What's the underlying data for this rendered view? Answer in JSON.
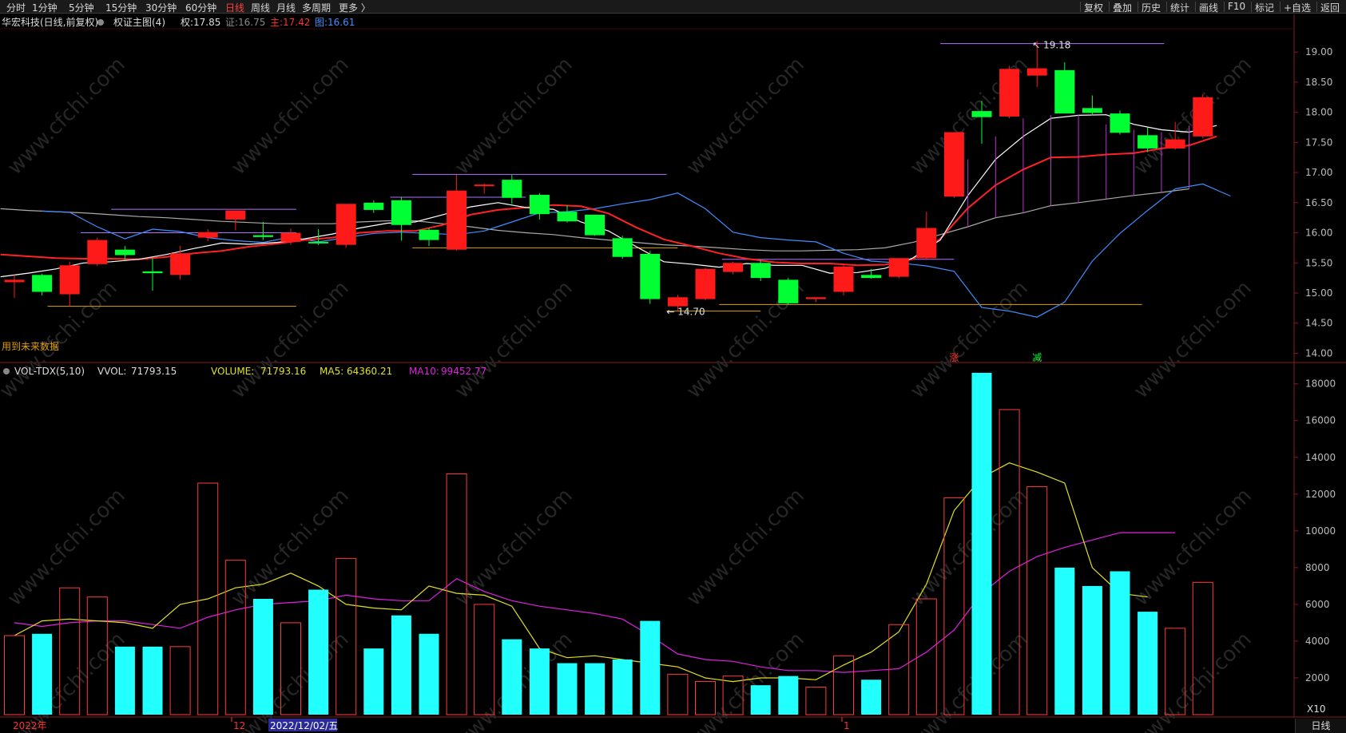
{
  "toolbar": {
    "left": [
      "分时",
      "1分钟",
      "5分钟",
      "15分钟",
      "30分钟",
      "60分钟",
      "日线",
      "周线",
      "月线",
      "多周期",
      "更多 〉"
    ],
    "active": "日线",
    "right": [
      "复权",
      "叠加",
      "历史",
      "统计",
      "画线",
      "F10",
      "标记",
      "+自选",
      "返回"
    ]
  },
  "price_header": {
    "stock": "华宏科技(日线,前复权)",
    "indicator": "权证主图(4)",
    "quan_label": "权:",
    "quan": "17.85",
    "zheng_label": "证:",
    "zheng": "16.75",
    "zhu_label": "主:",
    "zhu": "17.42",
    "tu_label": "图:",
    "tu": "16.61"
  },
  "vol_header": {
    "name": "VOL-TDX(5,10)",
    "vvol_label": "VVOL:",
    "vvol": "71793.15",
    "volume_label": "VOLUME:",
    "volume": "71793.16",
    "ma5_label": "MA5:",
    "ma5": "64360.21",
    "ma10_label": "MA10:",
    "ma10": "99452.77"
  },
  "annotations": {
    "high": "19.18",
    "low": "14.70",
    "future_note": "用到未来数据",
    "zhang": "涨",
    "jian": "减",
    "scale": "X10"
  },
  "watermark": "www.cfchi.com",
  "date_axis": {
    "year": "2022年",
    "m12": "12",
    "cursor": "2022/12/02/五",
    "m1": "1"
  },
  "status_word": "日线",
  "colors": {
    "up": "#ff1a1a",
    "down": "#00ff33",
    "vol_down": "#22ffff",
    "ma_white": "#ffffff",
    "ma_red": "#ff2222",
    "ma_gray": "#aaaaaa",
    "ma_blue": "#3f8fff",
    "vol_ma5": "#e0e020",
    "vol_ma10": "#e020e0",
    "level": "#e0a000",
    "hline": "#b070ff"
  },
  "chart_data": {
    "type": "candlestick",
    "price_axis": {
      "ticks": [
        14.0,
        14.5,
        15.0,
        15.5,
        16.0,
        16.5,
        17.0,
        17.5,
        18.0,
        18.5,
        19.0
      ],
      "range": [
        13.9,
        19.4
      ]
    },
    "volume_axis": {
      "ticks": [
        2000,
        4000,
        6000,
        8000,
        10000,
        12000,
        14000,
        16000,
        18000
      ],
      "range": [
        0,
        18900
      ]
    },
    "candles": [
      {
        "o": 15.18,
        "h": 15.3,
        "l": 14.92,
        "c": 15.22
      },
      {
        "o": 15.3,
        "h": 15.32,
        "l": 14.96,
        "c": 15.02
      },
      {
        "o": 14.98,
        "h": 15.52,
        "l": 14.78,
        "c": 15.46
      },
      {
        "o": 15.48,
        "h": 15.92,
        "l": 15.45,
        "c": 15.88
      },
      {
        "o": 15.72,
        "h": 15.78,
        "l": 15.55,
        "c": 15.63
      },
      {
        "o": 15.36,
        "h": 15.58,
        "l": 15.04,
        "c": 15.33
      },
      {
        "o": 15.3,
        "h": 15.78,
        "l": 15.22,
        "c": 15.66
      },
      {
        "o": 15.92,
        "h": 16.06,
        "l": 15.86,
        "c": 16.01
      },
      {
        "o": 16.22,
        "h": 16.35,
        "l": 16.04,
        "c": 16.37
      },
      {
        "o": 15.96,
        "h": 16.18,
        "l": 15.88,
        "c": 15.93
      },
      {
        "o": 15.85,
        "h": 16.07,
        "l": 15.8,
        "c": 16.0
      },
      {
        "o": 15.85,
        "h": 16.06,
        "l": 15.8,
        "c": 15.84
      },
      {
        "o": 15.8,
        "h": 16.43,
        "l": 15.75,
        "c": 16.48
      },
      {
        "o": 16.5,
        "h": 16.54,
        "l": 16.33,
        "c": 16.38
      },
      {
        "o": 16.54,
        "h": 16.59,
        "l": 15.87,
        "c": 16.13
      },
      {
        "o": 16.05,
        "h": 16.08,
        "l": 15.78,
        "c": 15.88
      },
      {
        "o": 15.72,
        "h": 16.96,
        "l": 15.7,
        "c": 16.7
      },
      {
        "o": 16.8,
        "h": 16.82,
        "l": 16.65,
        "c": 16.8
      },
      {
        "o": 16.88,
        "h": 16.96,
        "l": 16.48,
        "c": 16.58
      },
      {
        "o": 16.63,
        "h": 16.66,
        "l": 16.22,
        "c": 16.31
      },
      {
        "o": 16.35,
        "h": 16.46,
        "l": 16.17,
        "c": 16.19
      },
      {
        "o": 16.3,
        "h": 16.3,
        "l": 15.95,
        "c": 15.96
      },
      {
        "o": 15.91,
        "h": 15.95,
        "l": 15.57,
        "c": 15.6
      },
      {
        "o": 15.65,
        "h": 15.7,
        "l": 14.82,
        "c": 14.9
      },
      {
        "o": 14.78,
        "h": 14.97,
        "l": 14.7,
        "c": 14.93
      },
      {
        "o": 14.9,
        "h": 15.42,
        "l": 14.88,
        "c": 15.4
      },
      {
        "o": 15.35,
        "h": 15.52,
        "l": 15.31,
        "c": 15.5
      },
      {
        "o": 15.5,
        "h": 15.55,
        "l": 15.2,
        "c": 15.25
      },
      {
        "o": 15.22,
        "h": 15.25,
        "l": 14.8,
        "c": 14.83
      },
      {
        "o": 14.9,
        "h": 14.93,
        "l": 14.85,
        "c": 14.93
      },
      {
        "o": 15.02,
        "h": 15.47,
        "l": 14.96,
        "c": 15.44
      },
      {
        "o": 15.3,
        "h": 15.4,
        "l": 15.24,
        "c": 15.25
      },
      {
        "o": 15.27,
        "h": 15.57,
        "l": 15.24,
        "c": 15.58
      },
      {
        "o": 15.58,
        "h": 16.35,
        "l": 15.55,
        "c": 16.08
      },
      {
        "o": 16.6,
        "h": 17.67,
        "l": 16.58,
        "c": 17.67
      },
      {
        "o": 18.02,
        "h": 18.19,
        "l": 17.48,
        "c": 17.92
      },
      {
        "o": 17.93,
        "h": 18.77,
        "l": 17.9,
        "c": 18.72
      },
      {
        "o": 18.61,
        "h": 19.18,
        "l": 18.42,
        "c": 18.73
      },
      {
        "o": 18.7,
        "h": 18.83,
        "l": 17.98,
        "c": 17.98
      },
      {
        "o": 18.07,
        "h": 18.28,
        "l": 17.95,
        "c": 17.99
      },
      {
        "o": 17.98,
        "h": 18.03,
        "l": 17.63,
        "c": 17.66
      },
      {
        "o": 17.62,
        "h": 17.75,
        "l": 17.34,
        "c": 17.4
      },
      {
        "o": 17.4,
        "h": 17.84,
        "l": 17.38,
        "c": 17.55
      },
      {
        "o": 17.6,
        "h": 18.3,
        "l": 17.57,
        "c": 18.25
      }
    ],
    "volume": [
      4300,
      4400,
      6900,
      6400,
      3700,
      3700,
      3700,
      12600,
      8400,
      6300,
      5000,
      6800,
      8500,
      3600,
      5400,
      4400,
      13100,
      6000,
      4100,
      3600,
      2800,
      2800,
      3000,
      5100,
      2200,
      1800,
      2100,
      1600,
      2100,
      1500,
      3200,
      1900,
      4900,
      6300,
      11800,
      18600,
      16600,
      12400,
      8000,
      7000,
      7800,
      5600,
      4700,
      7200
    ],
    "ma_white": [
      15.27,
      15.33,
      15.4,
      15.5,
      15.52,
      15.56,
      15.64,
      15.74,
      15.83,
      15.81,
      15.84,
      15.9,
      15.98,
      16.08,
      16.16,
      16.18,
      16.3,
      16.43,
      16.5,
      16.42,
      16.39,
      16.18,
      16.03,
      15.77,
      15.52,
      15.48,
      15.43,
      15.49,
      15.46,
      15.46,
      15.33,
      15.34,
      15.41,
      15.58,
      15.88,
      16.62,
      17.22,
      17.6,
      17.9,
      17.95,
      17.96,
      17.8,
      17.71,
      17.67,
      17.78
    ],
    "ma_red": [
      15.64,
      15.61,
      15.58,
      15.57,
      15.57,
      15.56,
      15.6,
      15.66,
      15.7,
      15.77,
      15.82,
      15.88,
      15.92,
      16.0,
      16.03,
      16.03,
      16.13,
      16.3,
      16.38,
      16.42,
      16.46,
      16.44,
      16.32,
      16.09,
      15.89,
      15.78,
      15.66,
      15.57,
      15.51,
      15.49,
      15.49,
      15.46,
      15.47,
      15.56,
      15.9,
      16.41,
      16.79,
      17.05,
      17.25,
      17.26,
      17.3,
      17.32,
      17.4,
      17.45,
      17.6
    ],
    "ma_gray": [
      16.4,
      16.37,
      16.35,
      16.33,
      16.3,
      16.27,
      16.25,
      16.22,
      16.19,
      16.17,
      16.15,
      16.15,
      16.15,
      16.18,
      16.2,
      16.2,
      16.15,
      16.1,
      16.04,
      16.0,
      15.97,
      15.92,
      15.88,
      15.84,
      15.8,
      15.78,
      15.75,
      15.72,
      15.7,
      15.7,
      15.71,
      15.72,
      15.75,
      15.84,
      15.97,
      16.1,
      16.25,
      16.33,
      16.45,
      16.5,
      16.56,
      16.62,
      16.67,
      16.73
    ],
    "ma_blue": [
      16.36,
      16.34,
      16.1,
      15.9,
      16.06,
      16.02,
      15.92,
      15.87,
      15.84,
      15.93,
      15.85,
      15.92,
      15.99,
      16.01,
      15.99,
      15.97,
      16.03,
      16.18,
      16.33,
      16.35,
      16.4,
      16.48,
      16.55,
      16.66,
      16.4,
      16.01,
      15.92,
      15.88,
      15.85,
      15.66,
      15.53,
      15.5,
      15.45,
      15.36,
      14.76,
      14.7,
      14.6,
      14.85,
      15.53,
      15.99,
      16.37,
      16.73,
      16.81,
      16.61
    ],
    "vol_ma5": [
      4300,
      5100,
      5200,
      5100,
      5000,
      4700,
      6000,
      6300,
      6900,
      7100,
      7700,
      7000,
      6000,
      5800,
      5700,
      7000,
      6600,
      6500,
      5900,
      3600,
      3100,
      3200,
      3000,
      2800,
      2600,
      2000,
      1800,
      2000,
      2000,
      1900,
      2700,
      3400,
      4500,
      7100,
      11100,
      12900,
      13700,
      13200,
      12600,
      8000,
      6600,
      6400
    ],
    "vol_ma10": [
      5000,
      4800,
      5000,
      5100,
      5100,
      4900,
      4700,
      5300,
      5700,
      6000,
      6100,
      6200,
      6500,
      6300,
      6200,
      6200,
      7400,
      6700,
      6200,
      5900,
      5700,
      5500,
      5200,
      4300,
      3300,
      3000,
      2900,
      2600,
      2400,
      2400,
      2300,
      2400,
      2500,
      3400,
      4600,
      6600,
      7800,
      8600,
      9100,
      9500,
      9900,
      9900,
      9900
    ]
  }
}
